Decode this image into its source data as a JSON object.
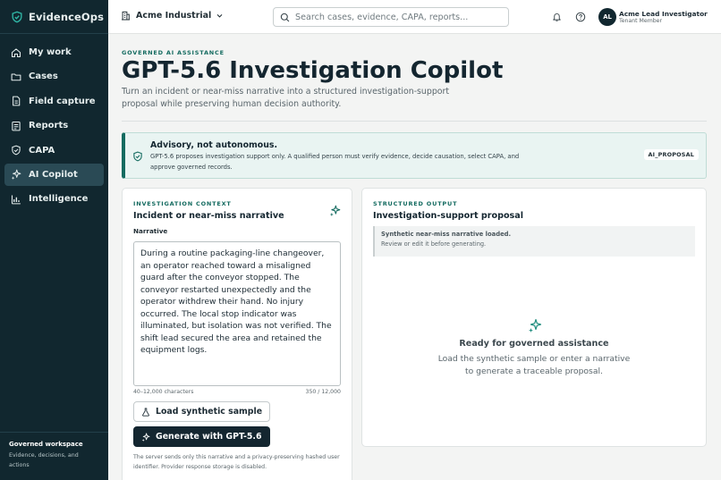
{
  "brand": {
    "name": "EvidenceOps",
    "icon": "shield-check-icon"
  },
  "nav": [
    {
      "label": "My work",
      "icon": "home-icon",
      "active": false
    },
    {
      "label": "Cases",
      "icon": "folder-icon",
      "active": false
    },
    {
      "label": "Field capture",
      "icon": "document-icon",
      "active": false
    },
    {
      "label": "Reports",
      "icon": "reports-icon",
      "active": false
    },
    {
      "label": "CAPA",
      "icon": "shield-check-icon",
      "active": false
    },
    {
      "label": "AI Copilot",
      "icon": "sparkle-icon",
      "active": true
    },
    {
      "label": "Intelligence",
      "icon": "bar-chart-icon",
      "active": false
    }
  ],
  "sidebar_footer": {
    "title": "Governed workspace",
    "text": "Evidence, decisions, and actions"
  },
  "topbar": {
    "org": "Acme Industrial",
    "search_placeholder": "Search cases, evidence, CAPA, reports...",
    "avatar_initials": "AL",
    "user_name": "Acme Lead Investigator",
    "user_role": "Tenant Member"
  },
  "header": {
    "eyebrow": "GOVERNED AI ASSISTANCE",
    "title": "GPT-5.6 Investigation Copilot",
    "subtitle": "Turn an incident or near-miss narrative into a structured investigation-support proposal while preserving human decision authority."
  },
  "advisory": {
    "title": "Advisory, not autonomous.",
    "text": "GPT-5.6 proposes investigation support only. A qualified person must verify evidence, decide causation, select CAPA, and approve governed records.",
    "badge": "AI_PROPOSAL"
  },
  "context": {
    "eyebrow": "INVESTIGATION CONTEXT",
    "title": "Incident or near-miss narrative",
    "field_label": "Narrative",
    "narrative": "During a routine packaging-line changeover, an operator reached toward a misaligned guard after the conveyor stopped. The conveyor restarted unexpectedly and the operator withdrew their hand. No injury occurred. The local stop indicator was illuminated, but isolation was not verified. The shift lead secured the area and retained the equipment logs.",
    "length_hint": "40–12,000 characters",
    "char_count": "350 / 12,000",
    "load_button": "Load synthetic sample",
    "generate_button": "Generate with GPT-5.6",
    "footnote": "The server sends only this narrative and a privacy-preserving hashed user identifier. Provider response storage is disabled."
  },
  "output": {
    "eyebrow": "STRUCTURED OUTPUT",
    "title": "Investigation-support proposal",
    "notice_title": "Synthetic near-miss narrative loaded.",
    "notice_text": "Review or edit it before generating.",
    "empty_title": "Ready for governed assistance",
    "empty_text": "Load the synthetic sample or enter a narrative to generate a traceable proposal."
  }
}
